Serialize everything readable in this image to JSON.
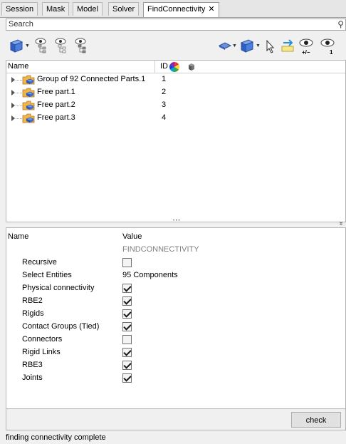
{
  "tabs": [
    {
      "label": "Session"
    },
    {
      "label": "Mask"
    },
    {
      "label": "Model"
    },
    {
      "label": "Solver"
    },
    {
      "label": "FindConnectivity",
      "close": "✕"
    }
  ],
  "search": {
    "placeholder": "Search"
  },
  "tree": {
    "columns": {
      "name": "Name",
      "id": "ID"
    },
    "rows": [
      {
        "label": "Group of 92 Connected Parts.1",
        "id": "1"
      },
      {
        "label": "Free part.1",
        "id": "2"
      },
      {
        "label": "Free part.2",
        "id": "3"
      },
      {
        "label": "Free part.3",
        "id": "4"
      }
    ]
  },
  "splitter": {
    "grip": "• • •",
    "collapse": "»"
  },
  "props": {
    "columns": {
      "name": "Name",
      "value": "Value"
    },
    "section": "FINDCONNECTIVITY",
    "rows": [
      {
        "name": "Recursive",
        "checked": false
      },
      {
        "name": "Select Entities",
        "value": "95 Components"
      },
      {
        "name": "Physical connectivity",
        "checked": true
      },
      {
        "name": "RBE2",
        "checked": true
      },
      {
        "name": "Rigids",
        "checked": true
      },
      {
        "name": "Contact Groups (Tied)",
        "checked": true
      },
      {
        "name": "Connectors",
        "checked": false
      },
      {
        "name": "Rigid Links",
        "checked": true
      },
      {
        "name": "RBE3",
        "checked": true
      },
      {
        "name": "Joints",
        "checked": true
      }
    ]
  },
  "check_button": "check",
  "status": "finding connectivity complete",
  "toolbar": {
    "eye_plusminus": "+/−",
    "eye_one": "1"
  }
}
